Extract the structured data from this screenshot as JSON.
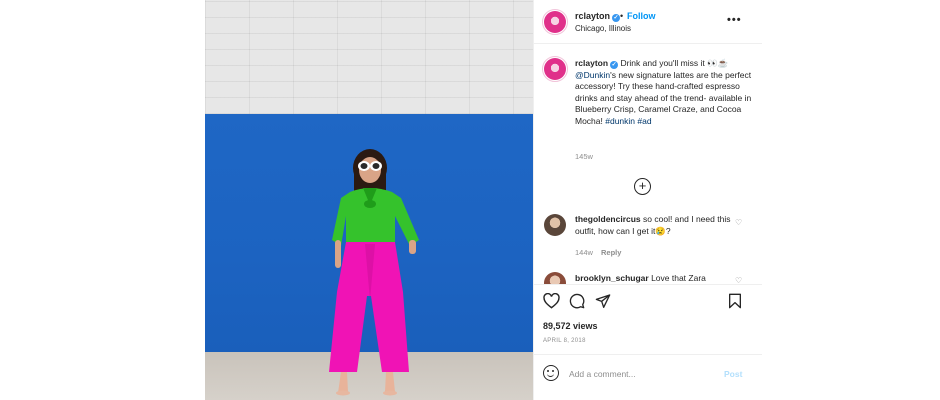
{
  "post": {
    "username": "rclayton",
    "verified_mark": "✓",
    "separator": "•",
    "follow_label": "Follow",
    "location": "Chicago, Illinois",
    "more_icon": "more-options-icon",
    "more_label": "•••"
  },
  "caption": {
    "username": "rclayton",
    "text_1": "Drink and you'll miss it 👀☕",
    "mention": "@Dunkin",
    "text_2": "'s new signature lattes are the perfect accessory! Try these hand-crafted espresso drinks and stay ahead of the trend- available in Blueberry Crisp, Caramel Craze, and Cocoa Mocha!",
    "tags": "#dunkin #ad",
    "age": "145w"
  },
  "load_more": {
    "label": "+",
    "icon": "plus-circle-icon"
  },
  "comments": [
    {
      "username": "thegoldencircus",
      "text": "so cool! and I need this outfit, how can I get it😢?",
      "age": "144w",
      "reply_label": "Reply"
    },
    {
      "username": "brooklyn_schugar",
      "text": "Love that Zara"
    }
  ],
  "actions": {
    "icons": [
      "heart-icon",
      "comment-icon",
      "share-icon",
      "bookmark-icon"
    ],
    "views": "89,572 views",
    "date": "APRIL 8, 2018"
  },
  "add_comment": {
    "placeholder": "Add a comment...",
    "post_label": "Post"
  },
  "colors": {
    "link_blue": "#0095f6",
    "post_disabled": "#b2dffc",
    "mention": "#00376b",
    "muted": "#8e8e8e",
    "wall_blue": "#1f67c5",
    "blouse_green": "#30b82b",
    "pants_pink": "#f013b5"
  }
}
